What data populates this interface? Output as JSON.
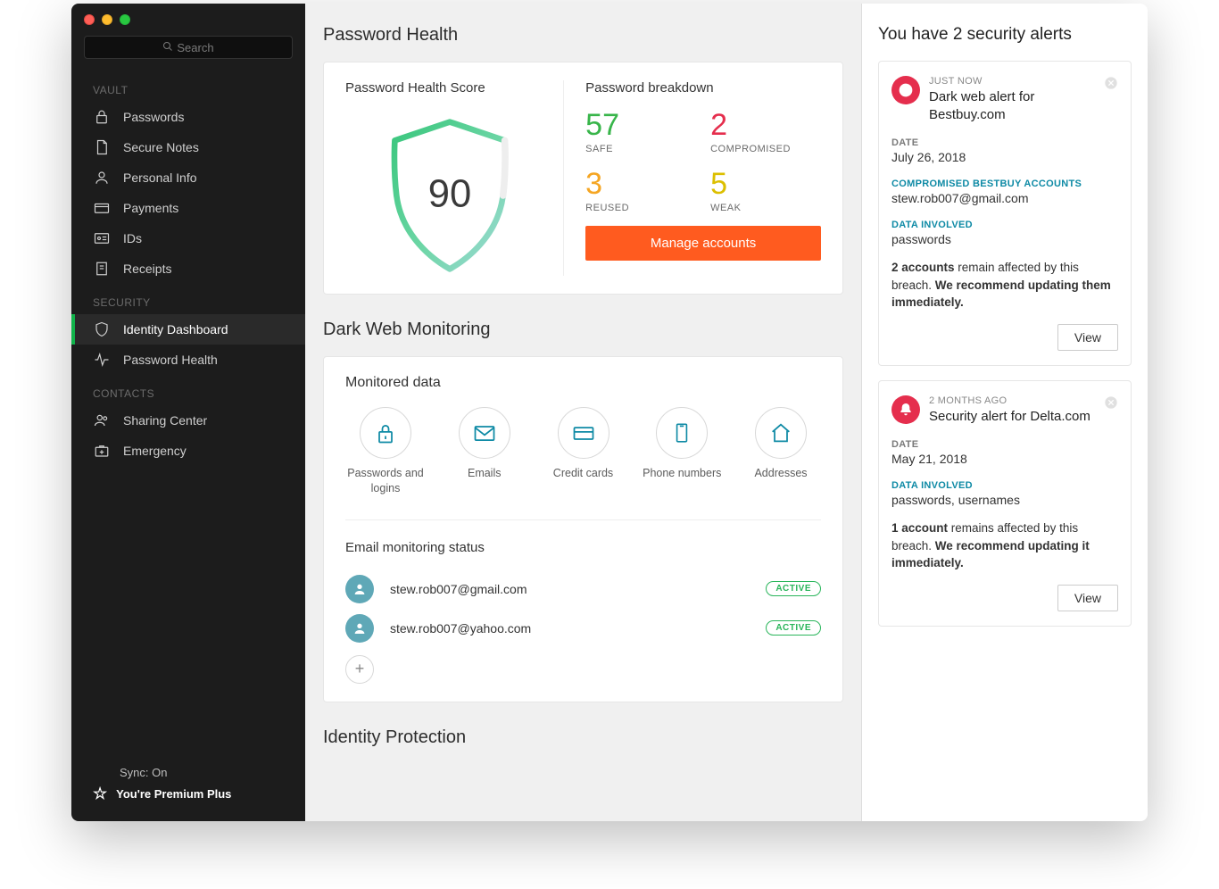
{
  "sidebar": {
    "search_placeholder": "Search",
    "sections": {
      "vault_label": "VAULT",
      "security_label": "SECURITY",
      "contacts_label": "CONTACTS"
    },
    "items": {
      "passwords": "Passwords",
      "secure_notes": "Secure Notes",
      "personal_info": "Personal Info",
      "payments": "Payments",
      "ids": "IDs",
      "receipts": "Receipts",
      "identity_dashboard": "Identity Dashboard",
      "password_health": "Password Health",
      "sharing_center": "Sharing Center",
      "emergency": "Emergency"
    },
    "footer": {
      "sync": "Sync: On",
      "premium": "You're Premium Plus"
    }
  },
  "main": {
    "password_health_heading": "Password Health",
    "score_title": "Password Health Score",
    "score_value": "90",
    "breakdown_title": "Password breakdown",
    "breakdown": {
      "safe_num": "57",
      "safe_label": "SAFE",
      "comp_num": "2",
      "comp_label": "COMPROMISED",
      "reused_num": "3",
      "reused_label": "REUSED",
      "weak_num": "5",
      "weak_label": "WEAK"
    },
    "manage_btn": "Manage accounts",
    "dark_web_heading": "Dark Web Monitoring",
    "monitored_data_title": "Monitored data",
    "monitors": {
      "passwords": "Passwords and logins",
      "emails": "Emails",
      "credit": "Credit cards",
      "phone": "Phone numbers",
      "addresses": "Addresses"
    },
    "email_status_title": "Email monitoring status",
    "emails": [
      {
        "address": "stew.rob007@gmail.com",
        "status": "ACTIVE"
      },
      {
        "address": "stew.rob007@yahoo.com",
        "status": "ACTIVE"
      }
    ],
    "identity_protection_heading": "Identity Protection"
  },
  "alerts": {
    "heading": "You have 2 security alerts",
    "items": [
      {
        "time": "JUST NOW",
        "title": "Dark web alert for Bestbuy.com",
        "date_label": "DATE",
        "date": "July 26, 2018",
        "accounts_label": "COMPROMISED BESTBUY ACCOUNTS",
        "accounts": "stew.rob007@gmail.com",
        "data_label": "DATA INVOLVED",
        "data": "passwords",
        "body_bold1": "2 accounts",
        "body_mid": " remain affected by this breach. ",
        "body_bold2": "We recommend updating them immediately.",
        "view": "View"
      },
      {
        "time": "2 MONTHS AGO",
        "title": "Security alert for Delta.com",
        "date_label": "DATE",
        "date": "May 21, 2018",
        "data_label": "DATA INVOLVED",
        "data": "passwords, usernames",
        "body_bold1": "1 account",
        "body_mid": " remains affected by this breach. ",
        "body_bold2": "We recommend updating it immediately.",
        "view": "View"
      }
    ]
  }
}
